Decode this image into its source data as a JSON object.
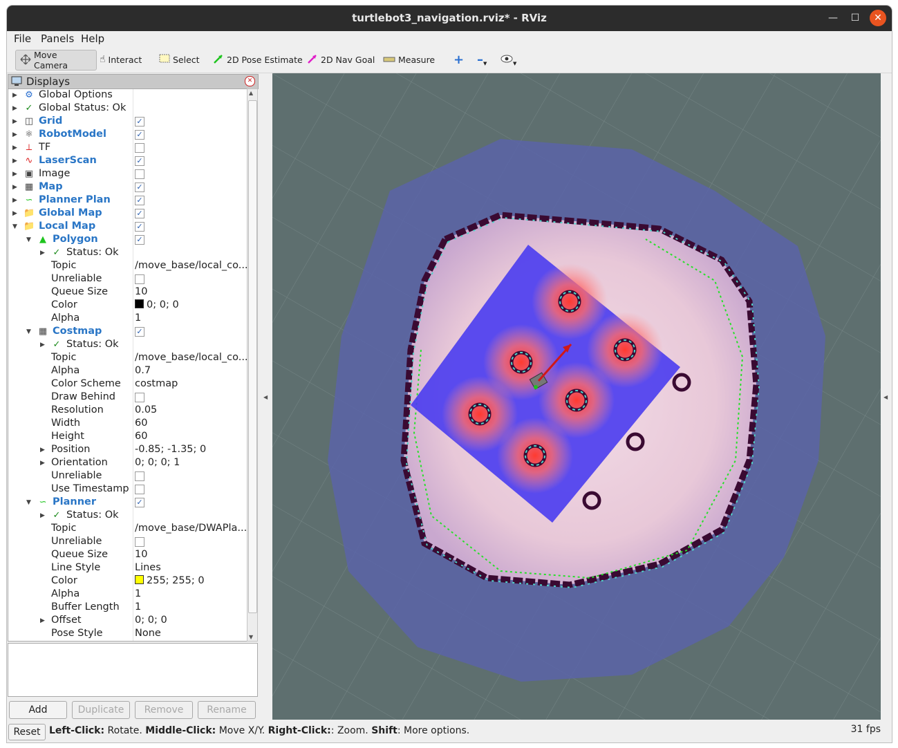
{
  "window": {
    "title": "turtlebot3_navigation.rviz* - RViz"
  },
  "menubar": {
    "file": "File",
    "panels": "Panels",
    "help": "Help"
  },
  "toolbar": {
    "move_camera": "Move Camera",
    "interact": "Interact",
    "select": "Select",
    "pose_estimate": "2D Pose Estimate",
    "nav_goal": "2D Nav Goal",
    "measure": "Measure"
  },
  "displays": {
    "title": "Displays",
    "rows": [
      {
        "label": "Global Options",
        "icon": "gear-icon"
      },
      {
        "label": "Global Status: Ok",
        "icon": "checkmark-icon"
      },
      {
        "label": "Grid",
        "icon": "grid-icon",
        "checked": true
      },
      {
        "label": "RobotModel",
        "icon": "robot-icon",
        "checked": true
      },
      {
        "label": "TF",
        "icon": "tf-axes-icon",
        "checked": false
      },
      {
        "label": "LaserScan",
        "icon": "laser-scan-icon",
        "checked": true
      },
      {
        "label": "Image",
        "icon": "image-icon",
        "checked": false
      },
      {
        "label": "Map",
        "icon": "map-icon",
        "checked": true
      },
      {
        "label": "Planner Plan",
        "icon": "path-icon",
        "checked": true
      },
      {
        "label": "Global Map",
        "icon": "folder-icon",
        "checked": true
      },
      {
        "label": "Local Map",
        "icon": "folder-icon",
        "checked": true
      },
      {
        "label": "Polygon",
        "icon": "polygon-icon",
        "checked": true
      },
      {
        "label": "Status: Ok",
        "icon": "checkmark-icon"
      },
      {
        "label": "Topic",
        "value": "/move_base/local_co..."
      },
      {
        "label": "Unreliable",
        "checked": false
      },
      {
        "label": "Queue Size",
        "value": "10"
      },
      {
        "label": "Color",
        "value": "0; 0; 0",
        "swatch": "#000000"
      },
      {
        "label": "Alpha",
        "value": "1"
      },
      {
        "label": "Costmap",
        "icon": "map-icon",
        "checked": true
      },
      {
        "label": "Status: Ok",
        "icon": "checkmark-icon"
      },
      {
        "label": "Topic",
        "value": "/move_base/local_co..."
      },
      {
        "label": "Alpha",
        "value": "0.7"
      },
      {
        "label": "Color Scheme",
        "value": "costmap"
      },
      {
        "label": "Draw Behind",
        "checked": false
      },
      {
        "label": "Resolution",
        "value": "0.05"
      },
      {
        "label": "Width",
        "value": "60"
      },
      {
        "label": "Height",
        "value": "60"
      },
      {
        "label": "Position",
        "value": "-0.85; -1.35; 0"
      },
      {
        "label": "Orientation",
        "value": "0; 0; 0; 1"
      },
      {
        "label": "Unreliable",
        "checked": false
      },
      {
        "label": "Use Timestamp",
        "checked": false
      },
      {
        "label": "Planner",
        "icon": "path-icon",
        "checked": true
      },
      {
        "label": "Status: Ok",
        "icon": "checkmark-icon"
      },
      {
        "label": "Topic",
        "value": "/move_base/DWAPla..."
      },
      {
        "label": "Unreliable",
        "checked": false
      },
      {
        "label": "Queue Size",
        "value": "10"
      },
      {
        "label": "Line Style",
        "value": "Lines"
      },
      {
        "label": "Color",
        "value": "255; 255; 0",
        "swatch": "#ffff00"
      },
      {
        "label": "Alpha",
        "value": "1"
      },
      {
        "label": "Buffer Length",
        "value": "1"
      },
      {
        "label": "Offset",
        "value": "0; 0; 0"
      },
      {
        "label": "Pose Style",
        "value": "None"
      }
    ],
    "buttons": {
      "add": "Add",
      "duplicate": "Duplicate",
      "remove": "Remove",
      "rename": "Rename"
    }
  },
  "statusbar": {
    "reset": "Reset",
    "hint_left_key": "Left-Click:",
    "hint_left": " Rotate. ",
    "hint_mid_key": "Middle-Click:",
    "hint_mid": " Move X/Y. ",
    "hint_right_key": "Right-Click:",
    "hint_right": ": Zoom. ",
    "hint_shift_key": "Shift",
    "hint_shift": ": More options.",
    "fps": "31 fps"
  },
  "colors": {
    "viewport_bg": "#5e6f6f",
    "inflation_blue": "#5a64a8",
    "costmap_blue": "#4a3cf0",
    "obstacle": "#3a0a32",
    "cost_ring": "#ff3a30",
    "accent_blue": "#2a76c6"
  }
}
